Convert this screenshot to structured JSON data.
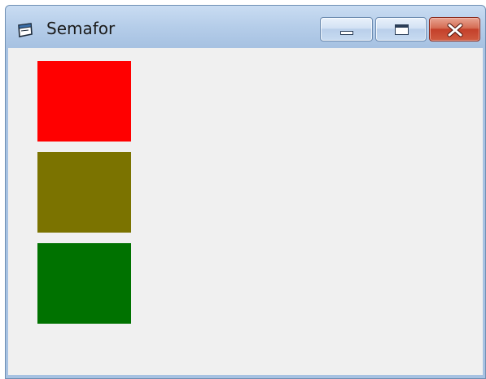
{
  "window": {
    "title": "Semafor",
    "title_icon": "form-window-icon",
    "caption_buttons": [
      "minimize-icon",
      "restore-icon",
      "close-icon"
    ]
  },
  "traffic_light": {
    "lamps": [
      {
        "name": "red-light",
        "color": "#ff0000"
      },
      {
        "name": "yellow-light",
        "color": "#7b7300"
      },
      {
        "name": "green-light",
        "color": "#007200"
      }
    ]
  }
}
